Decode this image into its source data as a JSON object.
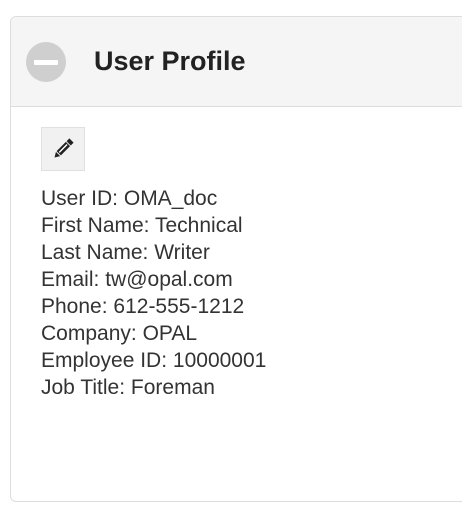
{
  "panel": {
    "title": "User Profile",
    "collapse_icon": "minus-circle-icon",
    "edit_icon": "pencil-icon"
  },
  "profile": {
    "fields": [
      {
        "label": "User ID:",
        "value": "OMA_doc"
      },
      {
        "label": "First Name:",
        "value": "Technical"
      },
      {
        "label": "Last Name:",
        "value": "Writer"
      },
      {
        "label": "Email:",
        "value": "tw@opal.com"
      },
      {
        "label": "Phone:",
        "value": "612-555-1212"
      },
      {
        "label": "Company:",
        "value": "OPAL"
      },
      {
        "label": "Employee ID:",
        "value": "10000001"
      },
      {
        "label": "Job Title:",
        "value": "Foreman"
      }
    ]
  }
}
